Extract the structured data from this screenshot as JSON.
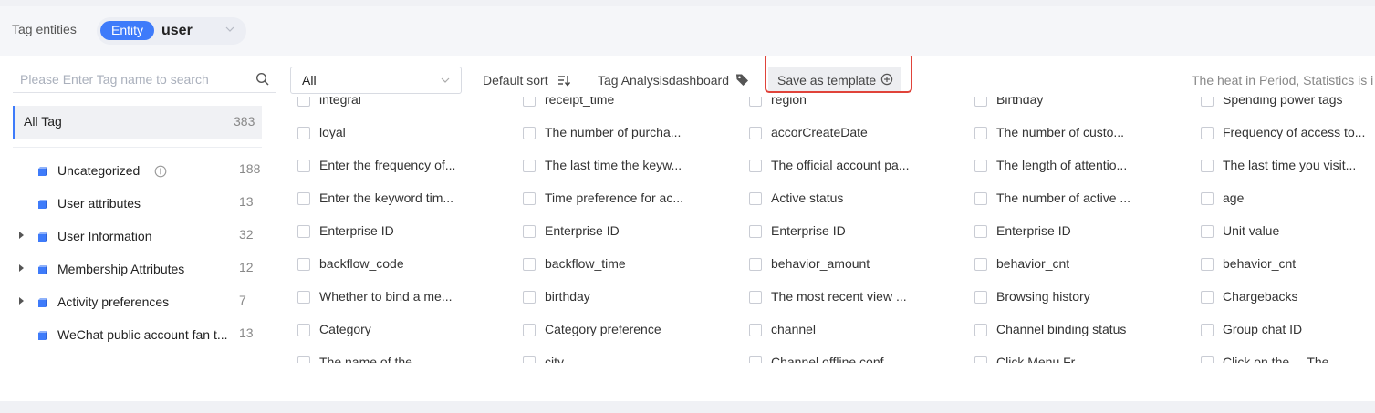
{
  "entity": {
    "label": "Tag entities",
    "pill": "Entity",
    "value": "user"
  },
  "sidebar": {
    "search_placeholder": "Please Enter Tag name to search",
    "all_tag": {
      "label": "All Tag",
      "count": "383"
    },
    "categories": [
      {
        "label": "Uncategorized",
        "count": "188",
        "expandable": false,
        "info": true
      },
      {
        "label": "User attributes",
        "count": "13",
        "expandable": false
      },
      {
        "label": "User Information",
        "count": "32",
        "expandable": true
      },
      {
        "label": "Membership Attributes",
        "count": "12",
        "expandable": true
      },
      {
        "label": "Activity preferences",
        "count": "7",
        "expandable": true
      },
      {
        "label": "WeChat public account fan t...",
        "count": "13",
        "expandable": false
      }
    ]
  },
  "toolbar": {
    "filter_value": "All",
    "sort_label": "Default sort",
    "dashboard_label": "Tag Analysisdashboard",
    "save_label": "Save as template",
    "heat_text": "The heat in Period, Statistics is i"
  },
  "tag_rows": [
    [
      "integral",
      "receipt_time",
      "region",
      "Birthday",
      "Spending power tags"
    ],
    [
      "loyal",
      "The number of purcha...",
      "accorCreateDate",
      "The number of custo...",
      "Frequency of access to..."
    ],
    [
      "Enter the frequency of...",
      "The last time the keyw...",
      "The official account pa...",
      "The length of attentio...",
      "The last time you visit..."
    ],
    [
      "Enter the keyword tim...",
      "Time preference for ac...",
      "Active status",
      "The number of active ...",
      "age"
    ],
    [
      "Enterprise ID",
      "Enterprise ID",
      "Enterprise ID",
      "Enterprise ID",
      "Unit value"
    ],
    [
      "backflow_code",
      "backflow_time",
      "behavior_amount",
      "behavior_cnt",
      "behavior_cnt"
    ],
    [
      "Whether to bind a me...",
      "birthday",
      "The most recent view ...",
      "Browsing history",
      "Chargebacks"
    ],
    [
      "Category",
      "Category preference",
      "channel",
      "Channel binding status",
      "Group chat ID"
    ],
    [
      "The name of the ...",
      "city",
      "Channel offline conf...",
      "Click Menu Fr...",
      "Click on the ... The..."
    ]
  ],
  "colors": {
    "accent": "#3e7bfa",
    "highlight": "#e0433a"
  }
}
